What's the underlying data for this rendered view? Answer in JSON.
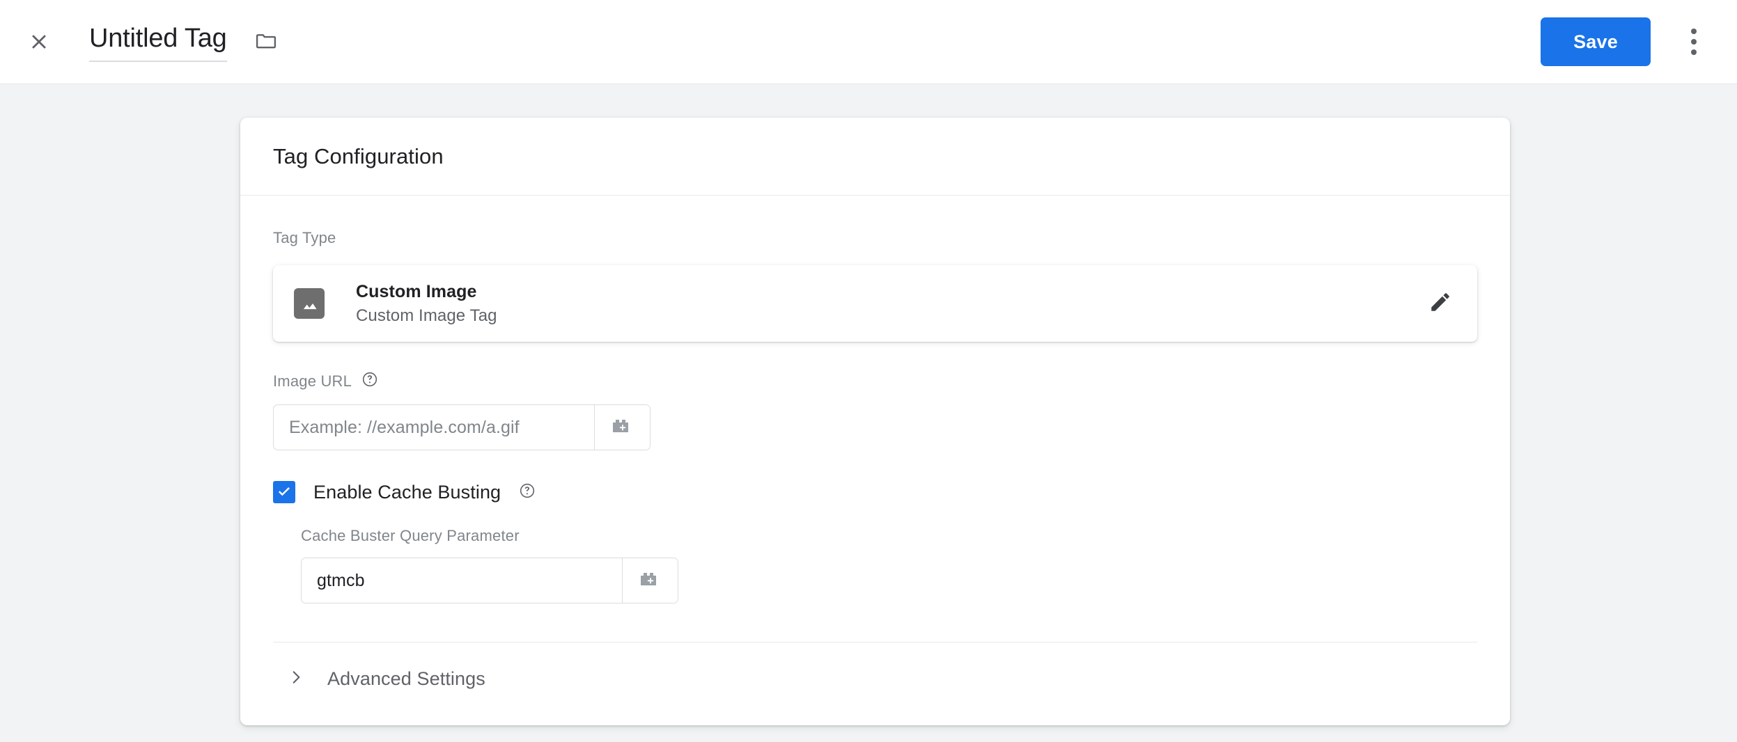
{
  "header": {
    "close_icon": "close-icon",
    "tag_title": "Untitled Tag",
    "folder_icon": "folder-icon",
    "save_label": "Save",
    "overflow_icon": "more-vert-icon",
    "accent_color": "#1a73e8"
  },
  "card": {
    "title": "Tag Configuration",
    "tag_type": {
      "label": "Tag Type",
      "icon": "image-icon",
      "name": "Custom Image",
      "description": "Custom Image Tag",
      "edit_icon": "pencil-icon"
    },
    "image_url": {
      "label": "Image URL",
      "help_icon": "help-circle-icon",
      "value": "",
      "placeholder": "Example: //example.com/a.gif",
      "variable_icon": "insert-variable-icon"
    },
    "cache_busting": {
      "label": "Enable Cache Busting",
      "checked": true,
      "help_icon": "help-circle-icon",
      "param_label": "Cache Buster Query Parameter",
      "param_value": "gtmcb",
      "param_placeholder": "",
      "variable_icon": "insert-variable-icon"
    },
    "advanced": {
      "label": "Advanced Settings",
      "expanded": false,
      "chevron_icon": "chevron-right-icon"
    }
  },
  "colors": {
    "page_background": "#f1f3f4",
    "card_background": "#ffffff",
    "primary_text": "#202124",
    "secondary_text": "#5f6368",
    "muted_text": "#80868b",
    "border": "#dadce0",
    "accent": "#1a73e8",
    "icon_tile": "#6e6e6e"
  }
}
